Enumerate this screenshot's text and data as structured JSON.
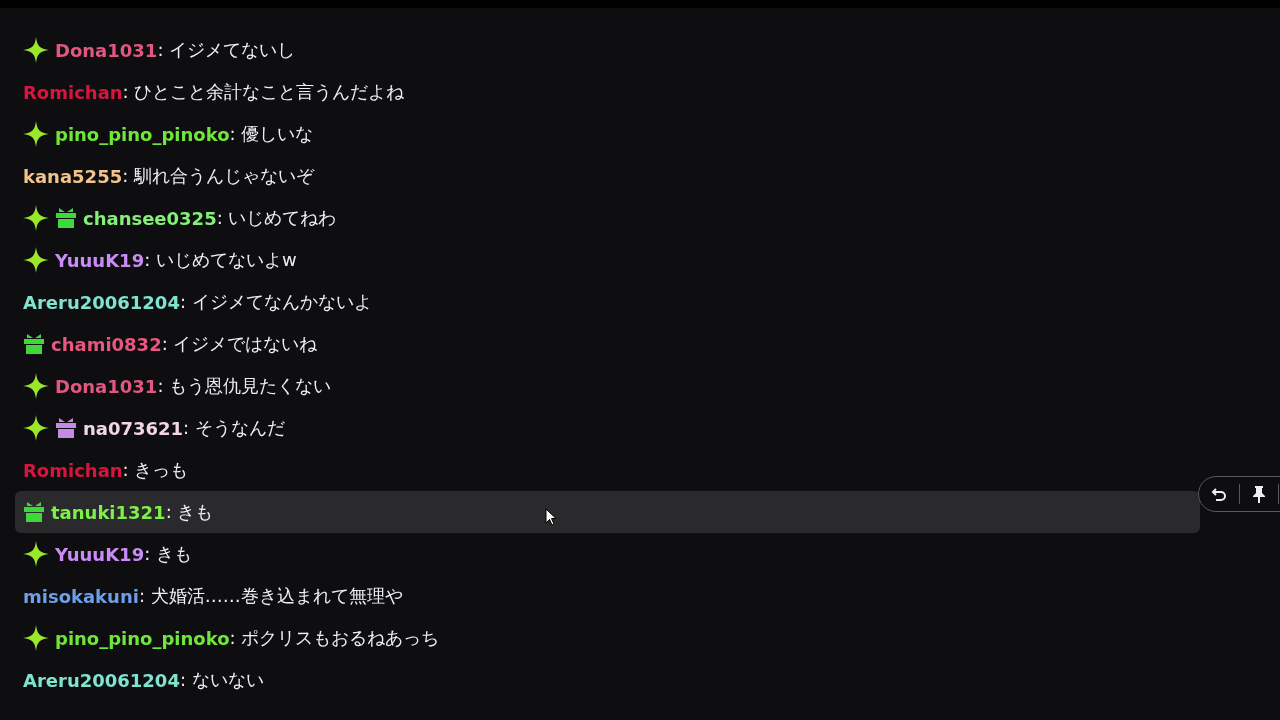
{
  "messages": [
    {
      "user": "Dona1031",
      "color": "#e0577f",
      "badges": [
        {
          "kind": "sparkle"
        }
      ],
      "text": ": イジメてないし",
      "selected": false
    },
    {
      "user": "Romichan",
      "color": "#d6163f",
      "text": ": ひとこと余計なこと言うんだよね",
      "selected": false
    },
    {
      "user": "pino_pino_pinoko",
      "color": "#6ee73a",
      "badges": [
        {
          "kind": "sparkle"
        }
      ],
      "text": ": 優しいな",
      "selected": false
    },
    {
      "user": "kana5255",
      "color": "#f2c48d",
      "text": ": 馴れ合うんじゃないぞ",
      "selected": false
    },
    {
      "user": "chansee0325",
      "color": "#86ef7a",
      "badges": [
        {
          "kind": "sparkle"
        },
        {
          "kind": "gift",
          "color": "#3fd83a"
        }
      ],
      "text": ": いじめてねわ",
      "selected": false
    },
    {
      "user": "YuuuK19",
      "color": "#c98bf5",
      "badges": [
        {
          "kind": "sparkle"
        }
      ],
      "text": ": いじめてないよw",
      "selected": false
    },
    {
      "user": "Areru20061204",
      "color": "#7fe3d0",
      "text": ": イジメてなんかないよ",
      "selected": false
    },
    {
      "user": "chami0832",
      "color": "#e8577f",
      "badges": [
        {
          "kind": "gift",
          "color": "#3fd83a"
        }
      ],
      "text": ": イジメではないね",
      "selected": false
    },
    {
      "user": "Dona1031",
      "color": "#e0577f",
      "badges": [
        {
          "kind": "sparkle"
        }
      ],
      "text": ": もう恩仇見たくない",
      "selected": false
    },
    {
      "user": "na073621",
      "color": "#f3d6e6",
      "badges": [
        {
          "kind": "sparkle"
        },
        {
          "kind": "gift",
          "color": "#c48ae6"
        }
      ],
      "text": ": そうなんだ",
      "selected": false
    },
    {
      "user": "Romichan",
      "color": "#d6163f",
      "text": ": きっも",
      "selected": false
    },
    {
      "user": "tanuki1321",
      "color": "#7ef04a",
      "badges": [
        {
          "kind": "gift",
          "color": "#3fd83a"
        }
      ],
      "text": ": きも",
      "selected": true
    },
    {
      "user": "YuuuK19",
      "color": "#c98bf5",
      "badges": [
        {
          "kind": "sparkle"
        }
      ],
      "text": ": きも",
      "selected": false
    },
    {
      "user": "misokakuni",
      "color": "#6f9ee8",
      "text": ": 犬婚活……巻き込まれて無理や",
      "selected": false
    },
    {
      "user": "pino_pino_pinoko",
      "color": "#6ee73a",
      "badges": [
        {
          "kind": "sparkle"
        }
      ],
      "text": ": ポクリスもおるねあっち",
      "selected": false
    },
    {
      "user": "Areru20061204",
      "color": "#7fe3d0",
      "text": ": ないない",
      "selected": false
    }
  ]
}
